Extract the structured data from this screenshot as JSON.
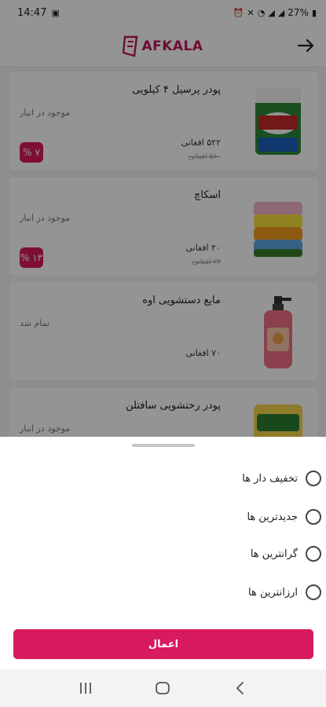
{
  "status_bar": {
    "time": "14:47",
    "battery": "27%"
  },
  "header": {
    "logo_text": "AFKALA",
    "brand_color": "#c2185b"
  },
  "products": [
    {
      "name": "پودر پرسیل ۴ کیلویی",
      "stock": "موجود در انبار",
      "price": "۵۲۲ افغانی",
      "old_price": "۵۶۰ افغانی",
      "discount": "۷ %"
    },
    {
      "name": "اسکاچ",
      "stock": "موجود در انبار",
      "price": "۲۰ افغانی",
      "old_price": "۲۳ افغانی",
      "discount": "۱۳ %"
    },
    {
      "name": "مایع دستشویی اوه",
      "stock": "تمام شد",
      "price": "۷۰ افغانی",
      "old_price": "",
      "discount": ""
    },
    {
      "name": "پودر رختشویی سافتلن",
      "stock": "موجود در انبار",
      "price": "",
      "old_price": "",
      "discount": ""
    }
  ],
  "sort_sheet": {
    "options": [
      "تخفیف دار ها",
      "جدیدترین ها",
      "گرانترین ها",
      "ارزانترین ها"
    ],
    "apply_label": "اعمال",
    "accent_color": "#d81b60"
  }
}
